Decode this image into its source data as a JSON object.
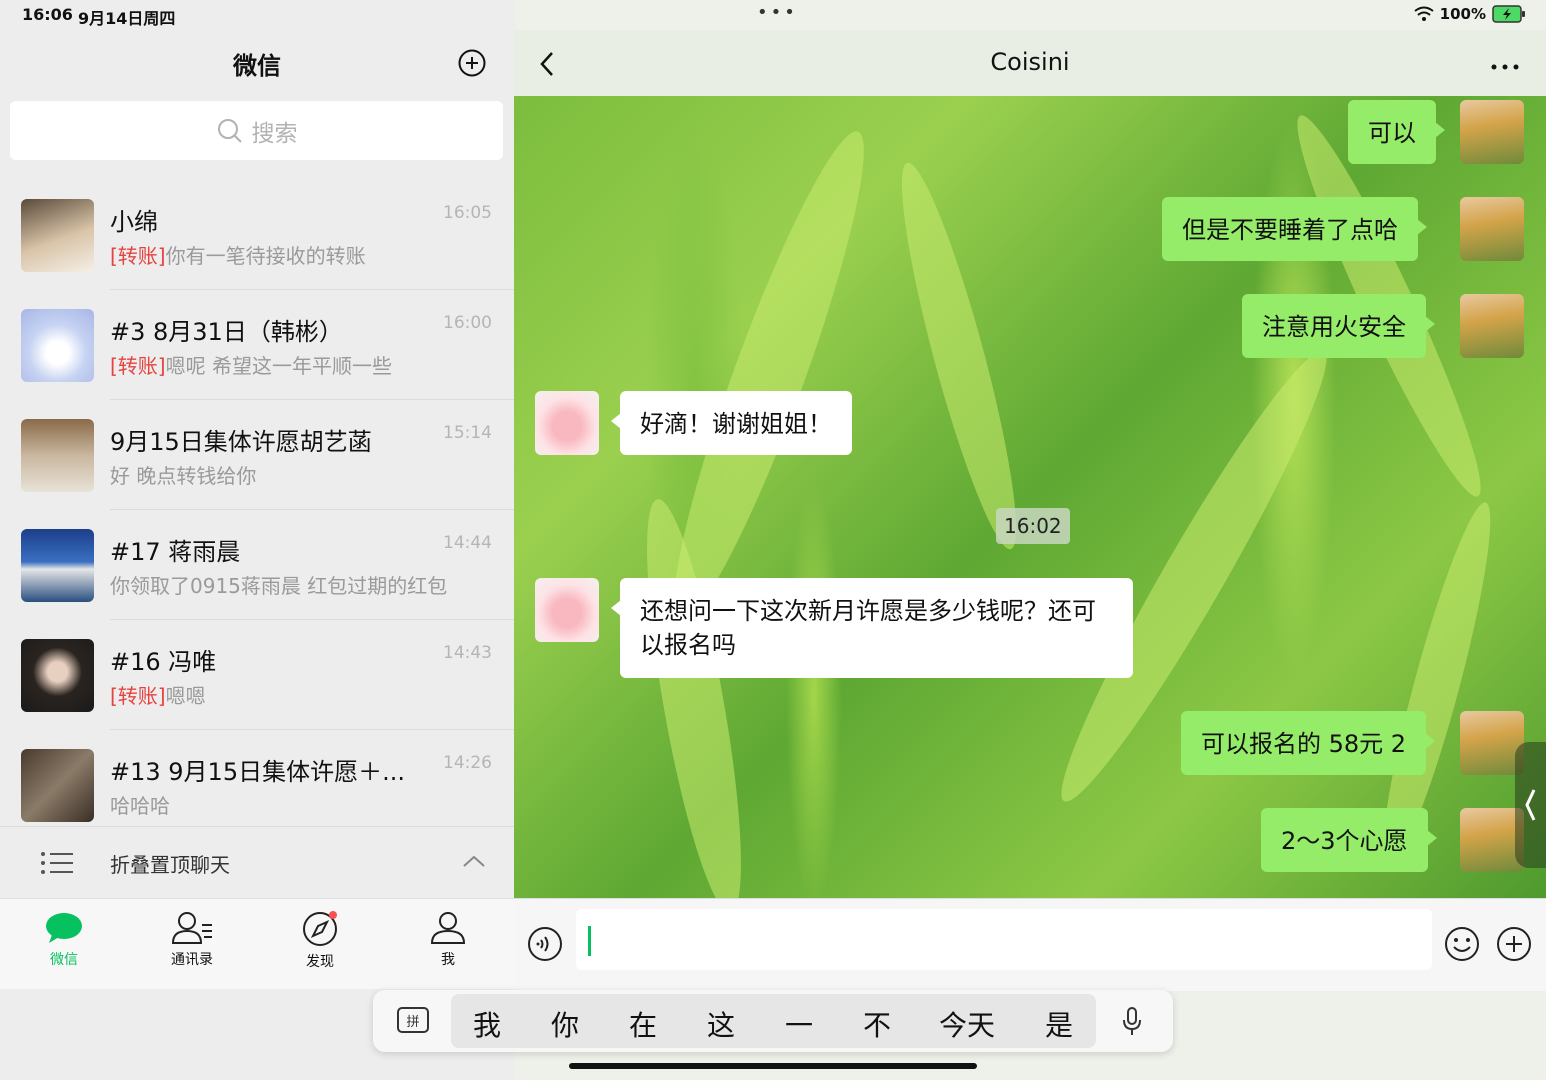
{
  "status": {
    "time": "16:06",
    "date": "9月14日周四",
    "battery": "100%"
  },
  "sidebar": {
    "title": "微信",
    "search_placeholder": "搜索",
    "chats": [
      {
        "name": "小绵",
        "time": "16:05",
        "tag": "[转账]",
        "preview": "你有一笔待接收的转账"
      },
      {
        "name": "#3 8月31日（韩彬）",
        "time": "16:00",
        "tag": "[转账]",
        "preview": "嗯呢 希望这一年平顺一些"
      },
      {
        "name": "9月15日集体许愿胡艺菡",
        "time": "15:14",
        "tag": "",
        "preview": "好 晚点转钱给你"
      },
      {
        "name": "#17 蒋雨晨",
        "time": "14:44",
        "tag": "",
        "preview": "你领取了0915蒋雨晨 红包过期的红包"
      },
      {
        "name": "#16 冯唯",
        "time": "14:43",
        "tag": "[转账]",
        "preview": "嗯嗯"
      },
      {
        "name": "#13 9月15日集体许愿＋...",
        "time": "14:26",
        "tag": "",
        "preview": "哈哈哈"
      }
    ],
    "fold_label": "折叠置顶聊天",
    "tabs": [
      {
        "label": "微信",
        "icon": "chat-bubble-icon",
        "active": true
      },
      {
        "label": "通讯录",
        "icon": "contacts-icon",
        "active": false
      },
      {
        "label": "发现",
        "icon": "compass-icon",
        "active": false
      },
      {
        "label": "我",
        "icon": "person-icon",
        "active": false
      }
    ]
  },
  "chat": {
    "title": "Coisini",
    "messages": [
      {
        "from": "me",
        "text": "可以"
      },
      {
        "from": "me",
        "text": "但是不要睡着了点哈"
      },
      {
        "from": "me",
        "text": "注意用火安全"
      },
      {
        "from": "them",
        "text": "好滴！谢谢姐姐！"
      },
      {
        "type": "time",
        "text": "16:02"
      },
      {
        "from": "them",
        "text": "还想问一下这次新月许愿是多少钱呢？还可以报名吗"
      },
      {
        "from": "me",
        "text": "可以报名的 58元 2"
      },
      {
        "from": "me",
        "text": "2～3个心愿"
      }
    ]
  },
  "keyboard": {
    "candidates": [
      "我",
      "你",
      "在",
      "这",
      "一",
      "不",
      "今天",
      "是"
    ]
  },
  "colors": {
    "accent": "#07c160",
    "my_bubble": "#95ec69",
    "transfer_tag": "#e64340"
  }
}
